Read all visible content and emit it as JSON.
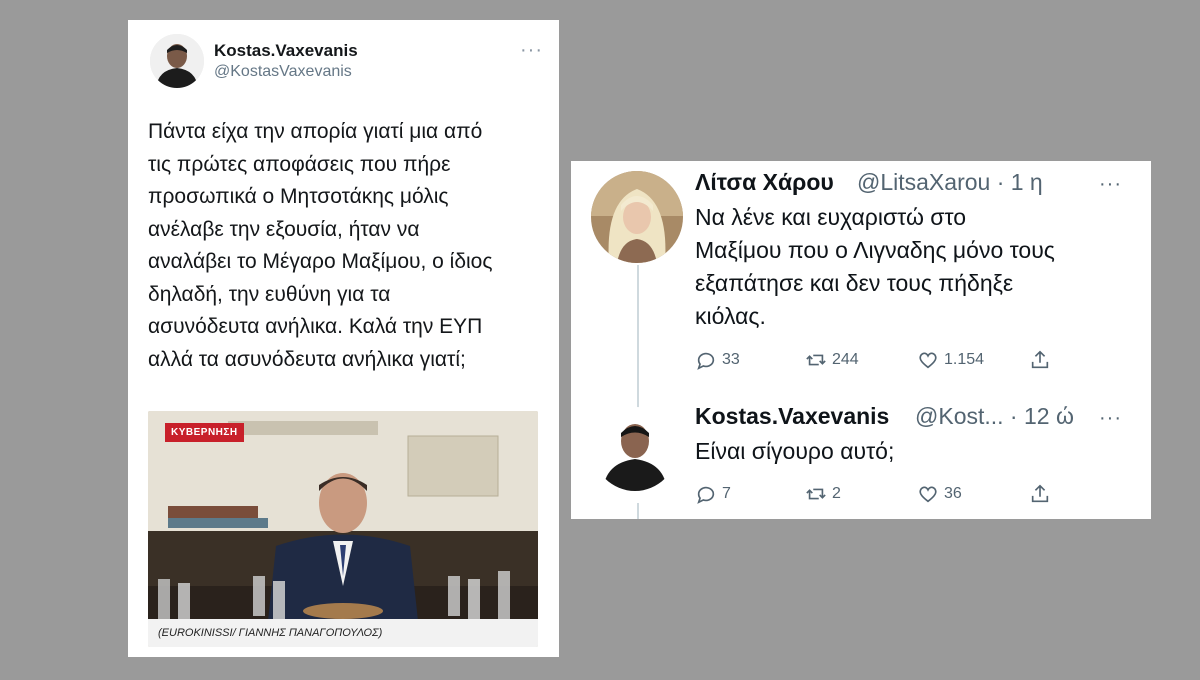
{
  "left_tweet": {
    "author_name": "Kostas.Vaxevanis",
    "author_handle": "@KostasVaxevanis",
    "more_icon": "ellipsis-icon",
    "text_lines": [
      "Πάντα είχα την απορία γιατί μια από",
      "τις πρώτες αποφάσεις που πήρε",
      "προσωπικά ο Μητσοτάκης μόλις",
      "ανέλαβε την εξουσία, ήταν να",
      "αναλάβει το Μέγαρο Μαξίμου, ο ίδιος",
      "δηλαδή, την ευθύνη για τα",
      "ασυνόδευτα ανήλικα. Καλά την ΕΥΠ",
      "αλλά τα ασυνόδευτα ανήλικα γιατί;"
    ],
    "media": {
      "tag": "ΚΥΒΕΡΝΗΣΗ",
      "caption": "(EUROKINISSI/ ΓΙΑΝΝΗΣ ΠΑΝΑΓΟΠΟΥΛΟΣ)"
    }
  },
  "right_screenshot": {
    "tweets": [
      {
        "author_name": "Λίτσα Χάρου",
        "meta": "@LitsaXarou · 1 η",
        "text_lines": [
          "Να λένε και ευχαριστώ στο",
          "Μαξίμου που ο Λιγναδης μόνο τους",
          "εξαπάτησε και δεν τους πήδηξε",
          "κιόλας."
        ],
        "replies": "33",
        "retweets": "244",
        "likes": "1.154"
      },
      {
        "author_name": "Kostas.Vaxevanis",
        "meta": "@Kost... · 12 ώ",
        "text_lines": [
          "Είναι σίγουρο αυτό;"
        ],
        "replies": "7",
        "retweets": "2",
        "likes": "36"
      }
    ]
  },
  "colors": {
    "background": "#9a9a9a",
    "card": "#ffffff",
    "text": "#14171a",
    "secondary": "#536471",
    "tag_red": "#c8202a"
  }
}
